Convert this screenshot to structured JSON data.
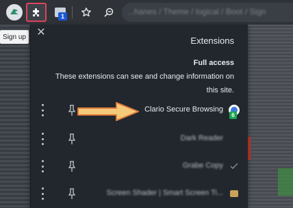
{
  "toolbar": {
    "extension_badge": "1",
    "omnibox_url": "...hanes / Theme / logical / Boot / Sign"
  },
  "page": {
    "signup_label": "Sign up"
  },
  "panel": {
    "title": "Extensions",
    "section_title": "Full access",
    "description": "These extensions can see and change information on this site.",
    "extensions": [
      {
        "name": "Clario Secure Browsing",
        "badge": "6",
        "highlighted": true
      },
      {
        "name": "Dark Reader"
      },
      {
        "name": "Grabe Copy"
      },
      {
        "name": "Screen Shader | Smart Screen Ti..."
      }
    ]
  },
  "colors": {
    "highlight_border": "#e0435c",
    "arrow_fill": "#f5c97a",
    "arrow_stroke": "#e07a3a",
    "panel_bg": "#22272e"
  }
}
